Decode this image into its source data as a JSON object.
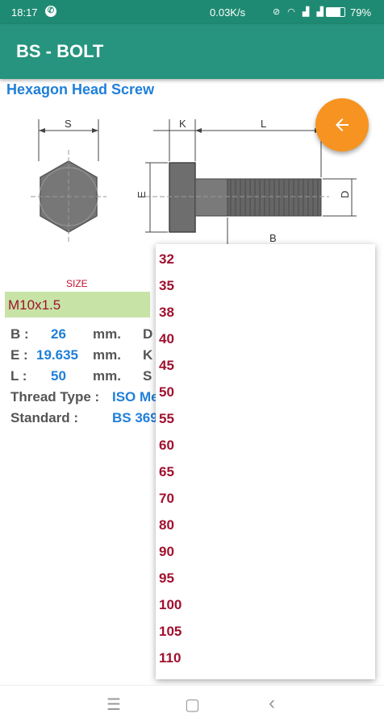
{
  "status": {
    "time": "18:17",
    "net_speed": "0.03K/s",
    "battery_text": "79%",
    "battery_level": 0.79
  },
  "app": {
    "title": "BS - BOLT",
    "subtitle": "Hexagon Head Screw"
  },
  "diagram": {
    "labels": {
      "s": "S",
      "k": "K",
      "l": "L",
      "e": "E",
      "d": "D",
      "b": "B"
    }
  },
  "fab": {
    "icon": "arrow-left-icon"
  },
  "size": {
    "label": "SIZE",
    "value": "M10x1.5"
  },
  "specs": {
    "b": {
      "label": "B :",
      "value": "26",
      "unit": "mm.",
      "peek": "D"
    },
    "e": {
      "label": "E :",
      "value": "19.635",
      "unit": "mm.",
      "peek": "K"
    },
    "l": {
      "label": "L :",
      "value": "50",
      "unit": "mm.",
      "peek": "S"
    },
    "thread": {
      "label": "Thread Type :",
      "value": "ISO Me"
    },
    "standard": {
      "label": "Standard :",
      "value": "BS 369"
    }
  },
  "dropdown": {
    "options": [
      "32",
      "35",
      "38",
      "40",
      "45",
      "50",
      "55",
      "60",
      "65",
      "70",
      "80",
      "90",
      "95",
      "100",
      "105",
      "110"
    ]
  },
  "navbar": {
    "menu": "☰",
    "home": "▢",
    "back": "‹"
  },
  "colors": {
    "appbar": "#26947e",
    "statusbar": "#1f8a73",
    "accent": "#f79320",
    "link_blue": "#1f7fd8",
    "crimson": "#a0102e",
    "size_field": "#c7e3a6"
  }
}
